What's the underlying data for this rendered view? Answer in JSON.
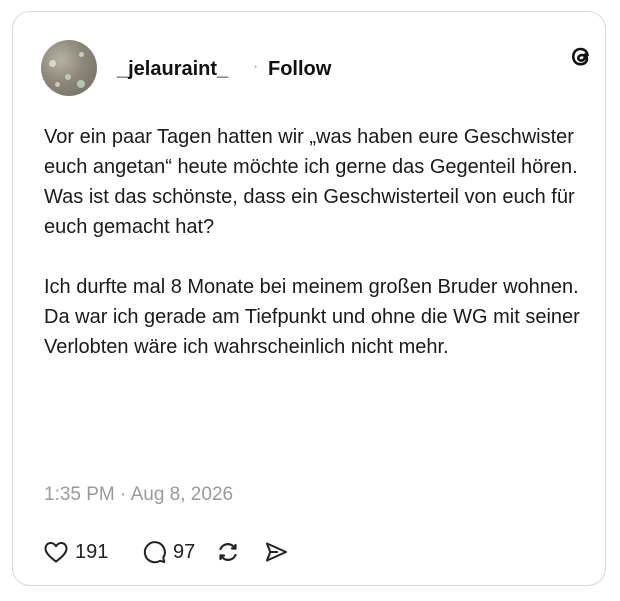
{
  "post": {
    "username": "_jelauraint_",
    "separator": "·",
    "follow_label": "Follow",
    "text": "Vor ein paar Tagen hatten wir „was haben eure Geschwister euch angetan“ heute möchte ich gerne das Gegenteil hören.\nWas ist das schönste, dass ein Geschwisterteil von euch für euch gemacht hat?\n\nIch durfte mal 8 Monate bei meinem großen Bruder wohnen.\nDa war ich gerade am Tiefpunkt und ohne die WG mit seiner Verlobten wäre ich wahrscheinlich nicht mehr.",
    "timestamp": "1:35 PM · Aug 8, 2026"
  },
  "actions": {
    "like_count": "191",
    "reply_count": "97"
  },
  "icons": {
    "brand": "threads-icon",
    "like": "heart-icon",
    "reply": "comment-icon",
    "repost": "repost-icon",
    "share": "share-icon"
  }
}
